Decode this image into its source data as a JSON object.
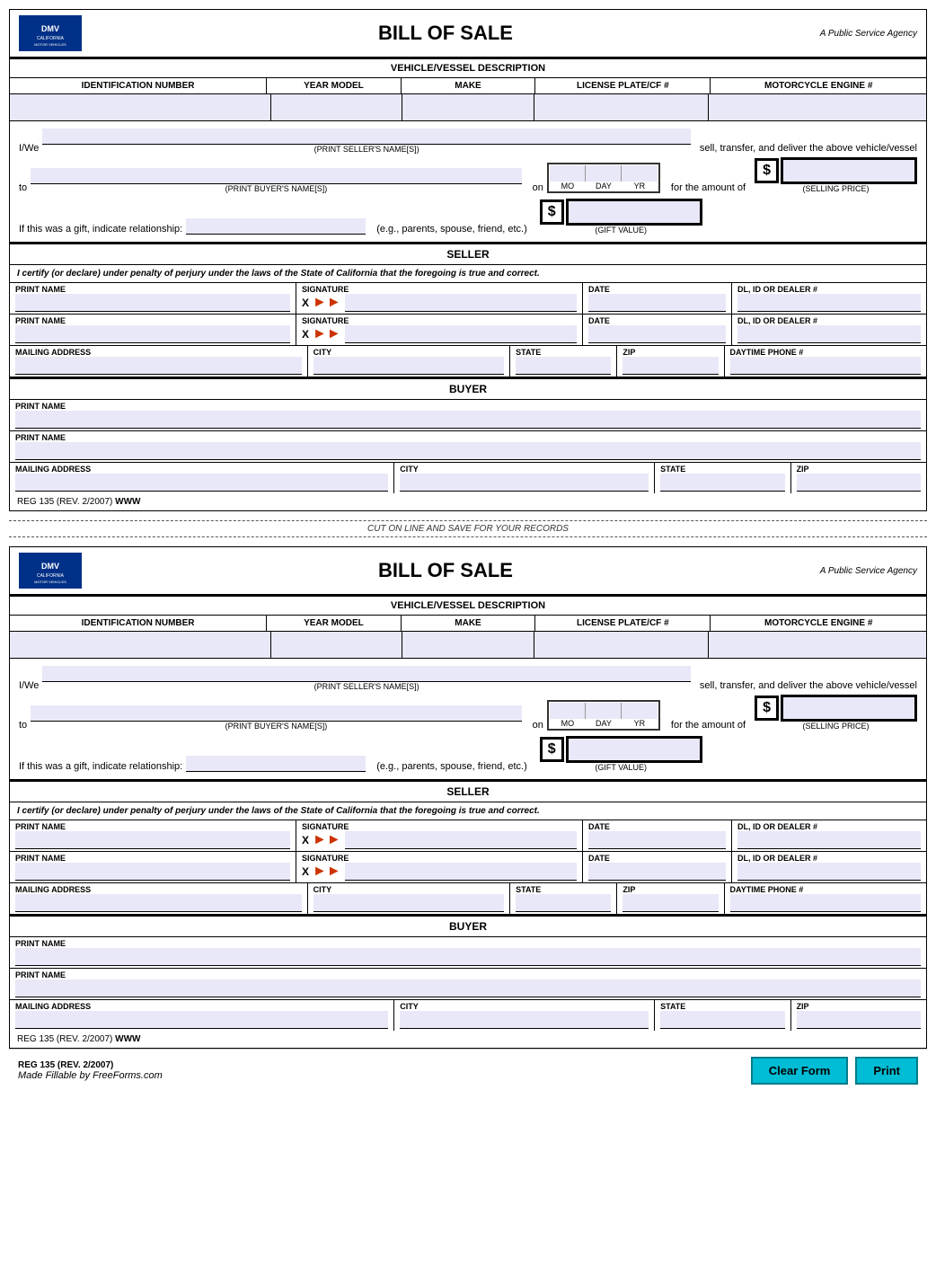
{
  "header": {
    "title": "BILL OF SALE",
    "agency": "A Public Service Agency"
  },
  "vehicle_section": {
    "title": "VEHICLE/VESSEL DESCRIPTION",
    "columns": [
      "IDENTIFICATION NUMBER",
      "YEAR MODEL",
      "MAKE",
      "LICENSE PLATE/CF #",
      "MOTORCYCLE ENGINE #"
    ]
  },
  "form": {
    "iwe_label": "I/We",
    "seller_sub": "(PRINT SELLER'S NAME[S])",
    "sell_text": "sell, transfer, and deliver the above vehicle/vessel",
    "to_label": "to",
    "on_label": "on",
    "mo_label": "MO",
    "day_label": "DAY",
    "yr_label": "YR",
    "for_amount_label": "for the amount of",
    "dollar_sign": "$",
    "selling_price_label": "(SELLING PRICE)",
    "gift_label": "If this was a gift, indicate relationship:",
    "gift_example": "(e.g., parents, spouse, friend, etc.)",
    "gift_value_label": "(GIFT VALUE)",
    "buyer_sub": "(PRINT BUYER'S NAME[S])"
  },
  "seller_section": {
    "title": "SELLER",
    "perjury_text": "I certify (or declare) under penalty of perjury under the laws of the State of California that the foregoing is true and correct.",
    "fields": {
      "print_name": "PRINT NAME",
      "signature": "SIGNATURE",
      "date": "DATE",
      "dl": "DL, ID OR DEALER #",
      "mailing_address": "MAILING ADDRESS",
      "city": "CITY",
      "state": "STATE",
      "zip": "ZIP",
      "daytime_phone": "DAYTIME PHONE #"
    },
    "x_label": "X"
  },
  "buyer_section": {
    "title": "BUYER",
    "fields": {
      "print_name": "PRINT NAME",
      "mailing_address": "MAILING ADDRESS",
      "city": "CITY",
      "state": "STATE",
      "zip": "ZIP"
    }
  },
  "footer": {
    "reg_text": "REG 135 (REV. 2/2007)",
    "www_text": "WWW",
    "cut_line": "CUT ON LINE AND SAVE FOR YOUR RECORDS",
    "made_by": "Made Fillable by FreeForms.com"
  },
  "buttons": {
    "clear_form": "Clear Form",
    "print": "Print"
  }
}
